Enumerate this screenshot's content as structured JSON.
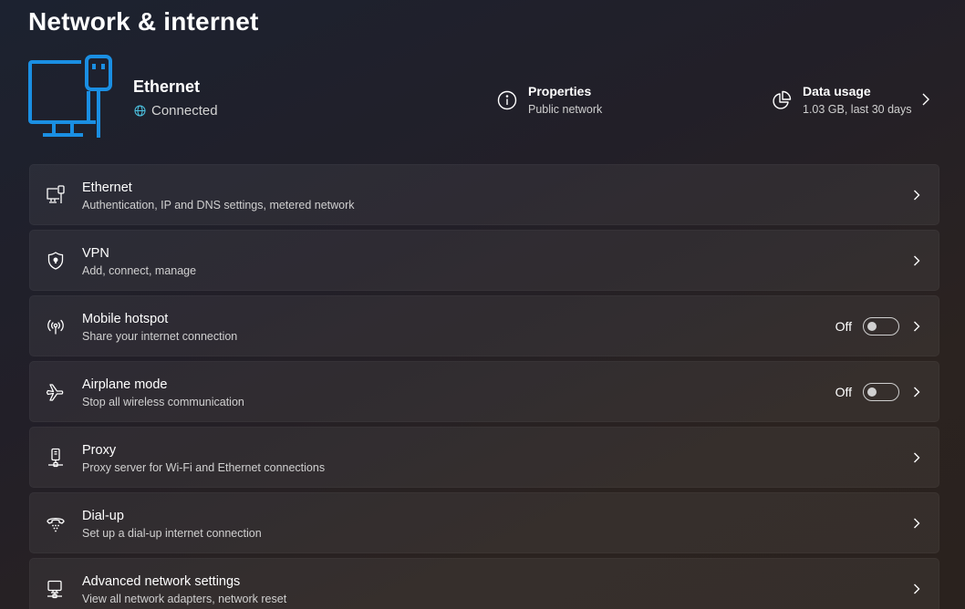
{
  "page": {
    "title": "Network & internet"
  },
  "hero": {
    "name": "Ethernet",
    "status": "Connected",
    "properties": {
      "title": "Properties",
      "subtitle": "Public network"
    },
    "data_usage": {
      "title": "Data usage",
      "subtitle": "1.03 GB, last 30 days"
    }
  },
  "items": [
    {
      "title": "Ethernet",
      "subtitle": "Authentication, IP and DNS settings, metered network",
      "icon": "ethernet-icon"
    },
    {
      "title": "VPN",
      "subtitle": "Add, connect, manage",
      "icon": "shield-icon"
    },
    {
      "title": "Mobile hotspot",
      "subtitle": "Share your internet connection",
      "icon": "hotspot-icon",
      "state": "Off"
    },
    {
      "title": "Airplane mode",
      "subtitle": "Stop all wireless communication",
      "icon": "airplane-icon",
      "state": "Off"
    },
    {
      "title": "Proxy",
      "subtitle": "Proxy server for Wi-Fi and Ethernet connections",
      "icon": "proxy-icon"
    },
    {
      "title": "Dial-up",
      "subtitle": "Set up a dial-up internet connection",
      "icon": "dialup-icon"
    },
    {
      "title": "Advanced network settings",
      "subtitle": "View all network adapters, network reset",
      "icon": "advanced-network-icon"
    }
  ],
  "colors": {
    "accent": "#1a8fe3",
    "status_globe": "#4cc2e0"
  }
}
